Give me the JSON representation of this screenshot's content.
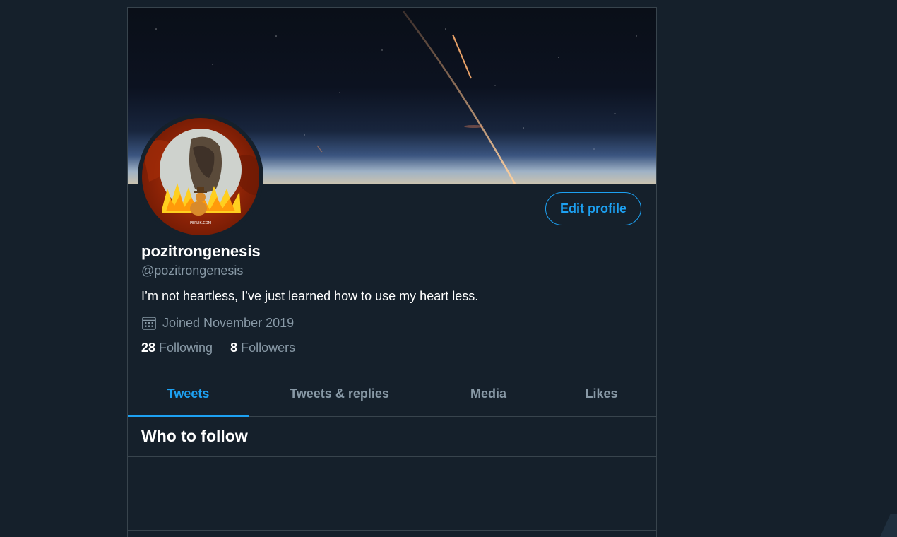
{
  "profile": {
    "display_name": "pozitrongenesis",
    "handle": "@pozitrongenesis",
    "bio": "I’m not heartless, I’ve just learned how to use my heart less.",
    "joined": "Joined November 2019",
    "avatar_caption": "PEPLIK.COM",
    "edit_label": "Edit profile"
  },
  "stats": {
    "following_count": "28",
    "following_label": "Following",
    "followers_count": "8",
    "followers_label": "Followers"
  },
  "tabs": [
    {
      "label": "Tweets",
      "active": true
    },
    {
      "label": "Tweets & replies",
      "active": false
    },
    {
      "label": "Media",
      "active": false
    },
    {
      "label": "Likes",
      "active": false
    }
  ],
  "who_to_follow": {
    "title": "Who to follow"
  },
  "icons": {
    "calendar": "calendar-icon"
  },
  "colors": {
    "background": "#15202b",
    "accent": "#1da1f2",
    "secondary_text": "#8899a6",
    "border": "#38444d"
  }
}
